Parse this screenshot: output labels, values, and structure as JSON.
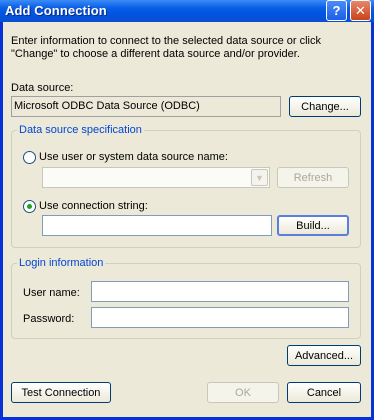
{
  "window": {
    "title": "Add Connection",
    "help_glyph": "?",
    "close_glyph": "✕"
  },
  "intro_text": "Enter information to connect to the selected data source or click \"Change\" to choose a different data source and/or provider.",
  "data_source": {
    "label": "Data source:",
    "value": "Microsoft ODBC Data Source (ODBC)",
    "change_label": "Change..."
  },
  "spec": {
    "title": "Data source specification",
    "option_dsn": "Use user or system data source name:",
    "dsn_value": "",
    "refresh_label": "Refresh",
    "option_connstr": "Use connection string:",
    "connstr_value": "",
    "build_label": "Build...",
    "selected": "connection-string"
  },
  "login": {
    "title": "Login information",
    "user_label": "User name:",
    "user_value": "",
    "password_label": "Password:",
    "password_value": ""
  },
  "buttons": {
    "advanced": "Advanced...",
    "test": "Test Connection",
    "ok": "OK",
    "cancel": "Cancel"
  }
}
